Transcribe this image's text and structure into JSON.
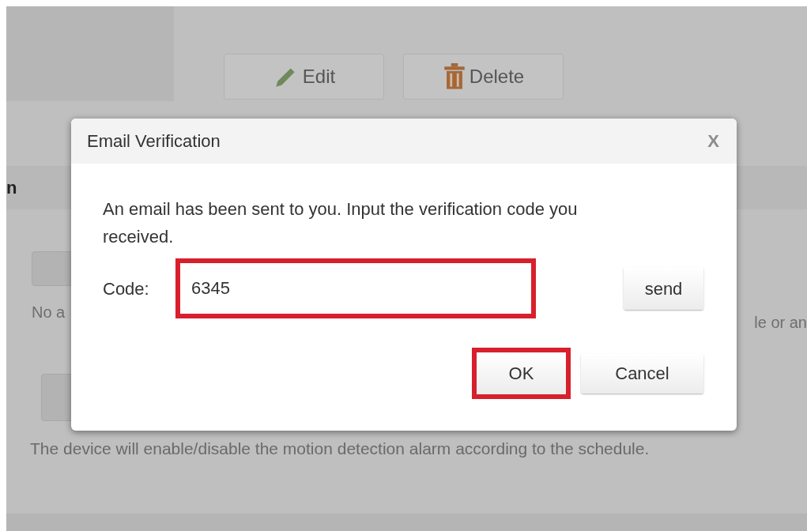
{
  "background": {
    "buttons": [
      {
        "label": "Edit",
        "kind": "edit"
      },
      {
        "label": "Delete",
        "kind": "delete"
      }
    ],
    "section_heading": "n",
    "partial_left": "No a",
    "partial_right": "le or an",
    "schedule_note": "The device will enable/disable the motion detection alarm according to the schedule."
  },
  "dialog": {
    "title": "Email Verification",
    "close": "X",
    "message": "An email has been sent to you. Input the verification code you received.",
    "code_label": "Code:",
    "code_field": {
      "value": "6345",
      "highlighted": true
    },
    "send_button": {
      "label": "send",
      "highlighted": false
    },
    "buttons": [
      {
        "label": "OK",
        "highlighted": true
      },
      {
        "label": "Cancel",
        "highlighted": false
      }
    ]
  }
}
